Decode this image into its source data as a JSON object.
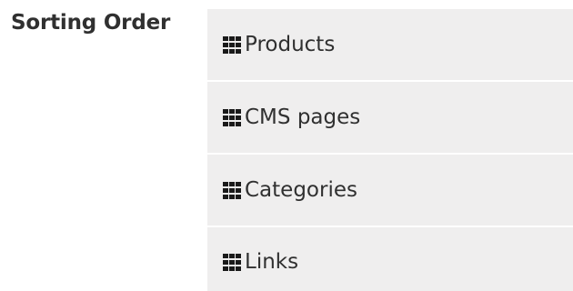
{
  "field": {
    "label": "Sorting Order"
  },
  "sort_items": [
    {
      "label": "Products",
      "icon": "drag-grid-icon"
    },
    {
      "label": "CMS pages",
      "icon": "drag-grid-icon"
    },
    {
      "label": "Categories",
      "icon": "drag-grid-icon"
    },
    {
      "label": "Links",
      "icon": "drag-grid-icon"
    }
  ],
  "colors": {
    "item_background": "#efeeee",
    "text": "#303030"
  }
}
